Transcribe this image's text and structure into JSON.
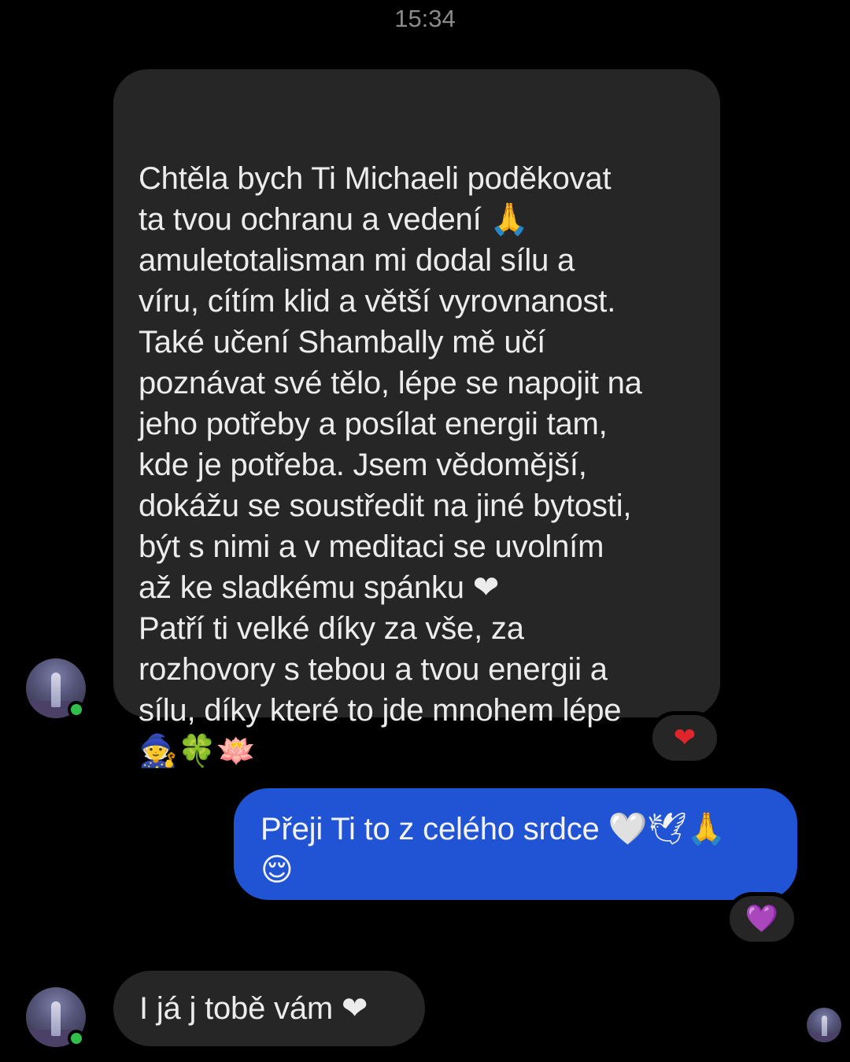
{
  "header": {
    "timestamp": "15:34"
  },
  "messages": [
    {
      "direction": "incoming",
      "lines": [
        "Chtěla bych Ti Michaeli poděkovat",
        "ta tvou ochranu a vedení 🙏",
        "amuletotalisman mi dodal sílu a",
        "víru, cítím klid a větší vyrovnanost.",
        "Také učení Shambally mě učí",
        "poznávat své tělo, lépe se napojit na",
        "jeho potřeby a posílat energii tam,",
        "kde je potřeba. Jsem vědomější,",
        "dokážu se soustředit na jiné bytosti,",
        "být s nimi a v meditaci se uvolním",
        "až ke sladkému spánku ❤",
        "Patří ti velké díky za vše, za",
        "rozhovory s tebou a tvou energii a",
        "sílu, díky které to jde mnohem lépe",
        "🧙🍀🪷"
      ],
      "reaction": "❤"
    },
    {
      "direction": "outgoing",
      "lines": [
        "Přeji Ti to z celého srdce 🤍🕊🙏",
        "😌"
      ],
      "reaction": "💜"
    },
    {
      "direction": "incoming",
      "lines": [
        "I já j tobě vám ❤"
      ]
    }
  ],
  "colors": {
    "background": "#000000",
    "incoming_bubble": "#262626",
    "outgoing_bubble": "#2154d4",
    "online_indicator": "#2fbf4a",
    "heart": "#e0262c",
    "purple_heart": "#8a3fe0"
  },
  "icons": {
    "avatar": "profile-photo",
    "online": "online-status-dot",
    "read_receipt": "read-receipt-avatar"
  }
}
